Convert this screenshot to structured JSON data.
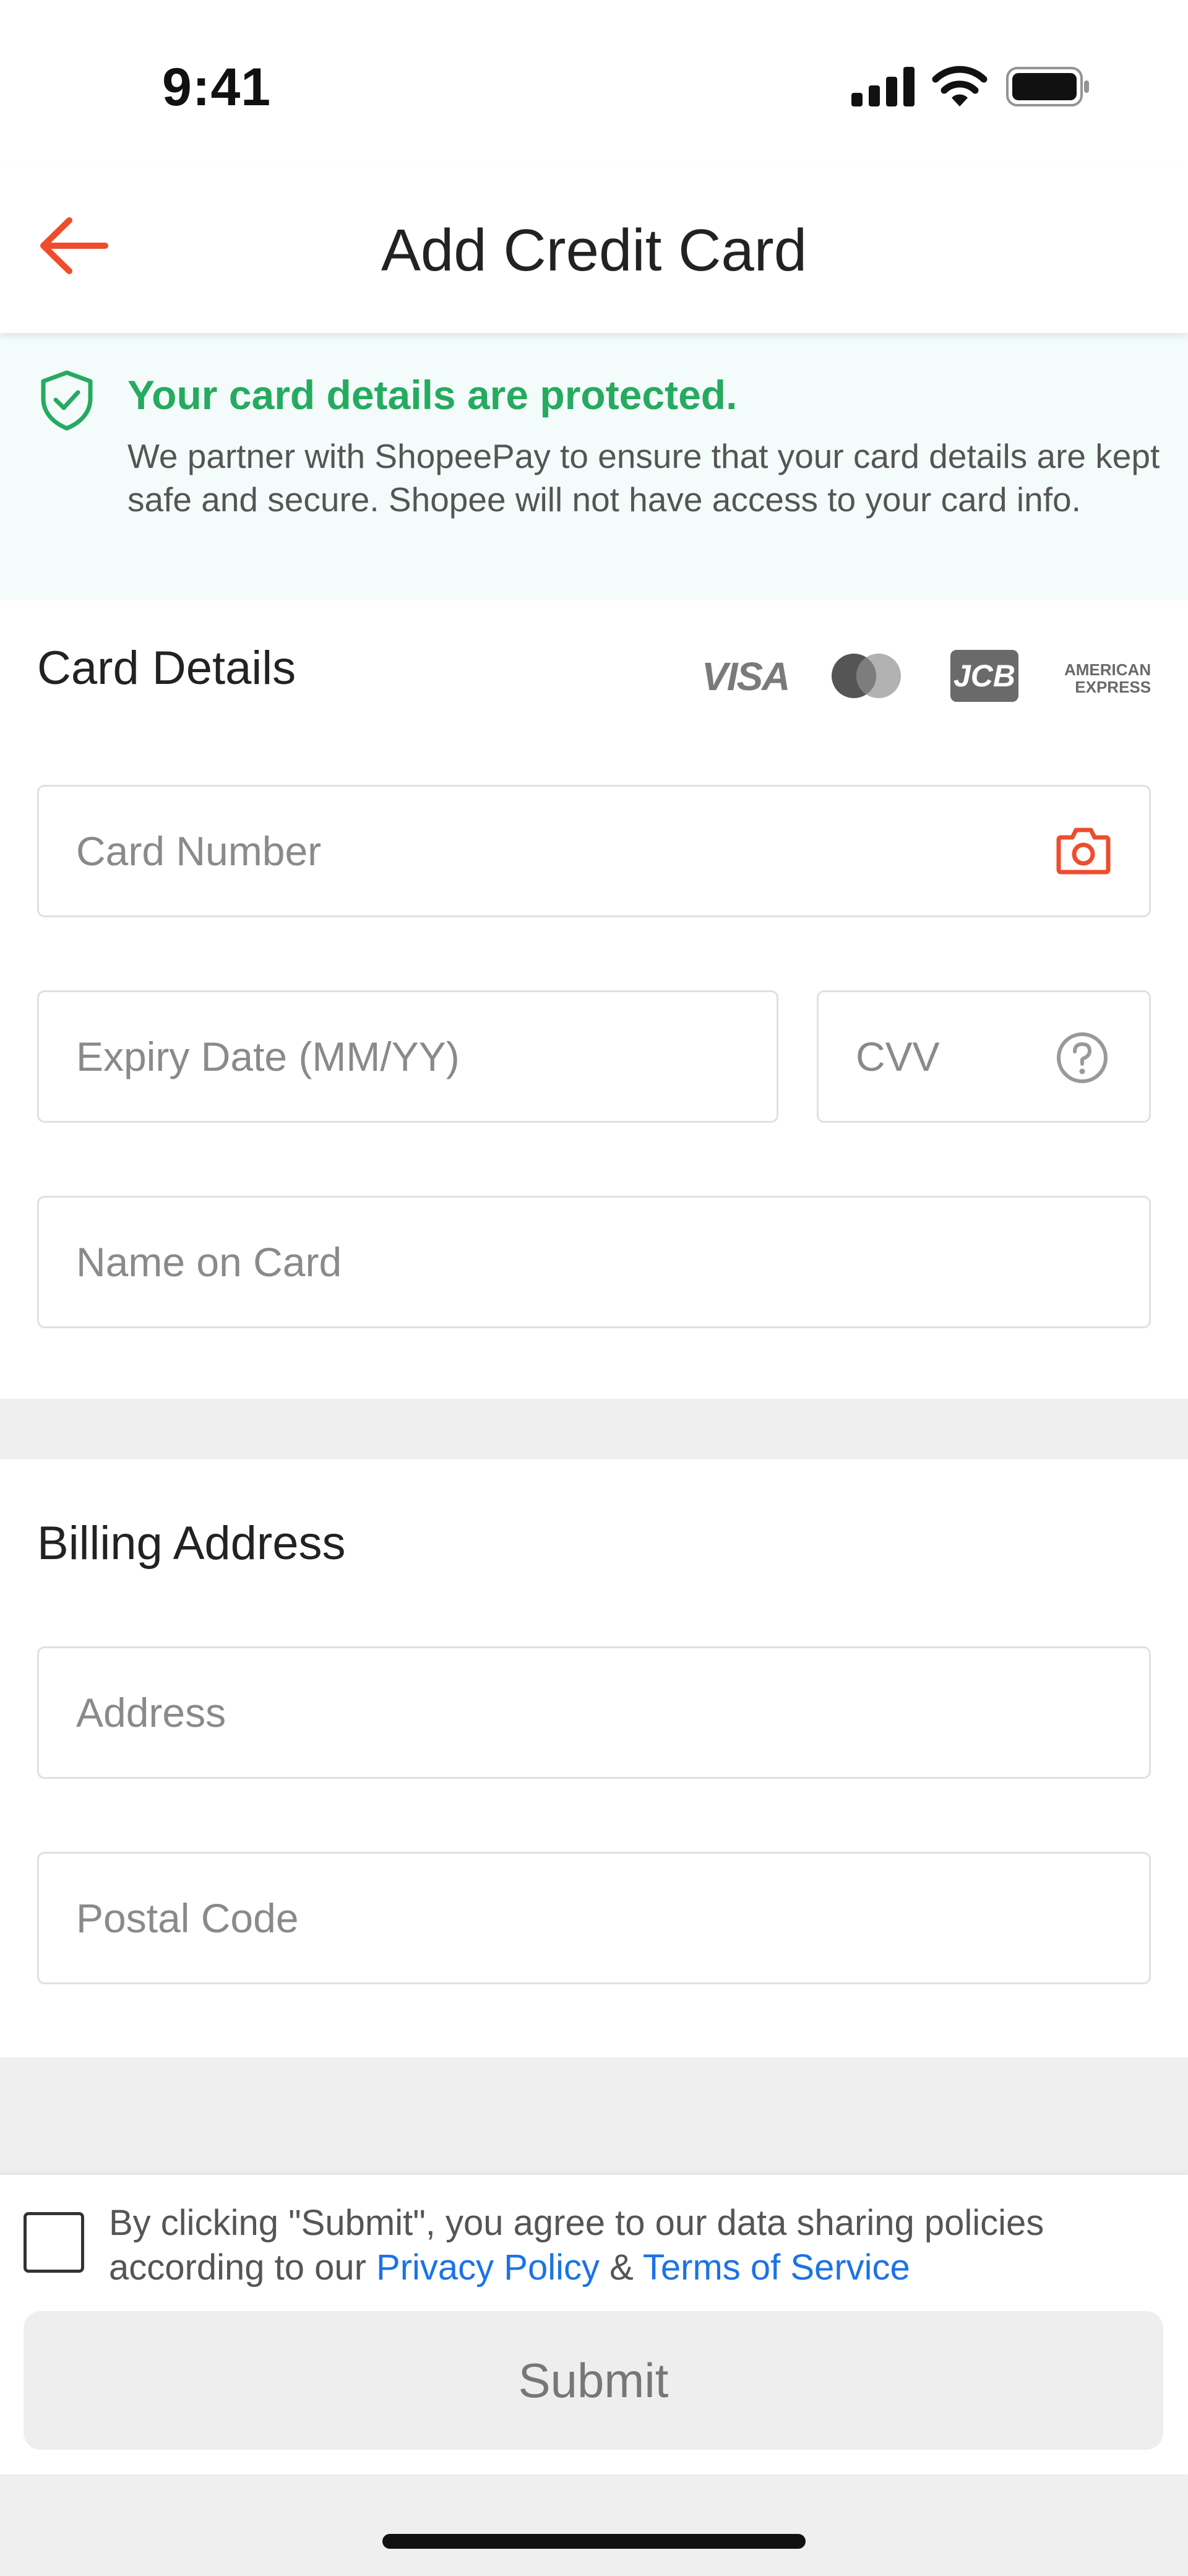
{
  "status_bar": {
    "time": "9:41"
  },
  "nav": {
    "title": "Add Credit Card"
  },
  "protection": {
    "title": "Your card details are protected.",
    "description": "We partner with ShopeePay to ensure that your card details are kept safe and secure. Shopee will not have access to your card info."
  },
  "card_details": {
    "title": "Card Details",
    "brands": {
      "visa": "VISA",
      "jcb": "JCB",
      "amex_line1": "AMERICAN",
      "amex_line2": "EXPRESS"
    },
    "card_number": {
      "placeholder": "Card Number",
      "value": ""
    },
    "expiry": {
      "placeholder": "Expiry Date (MM/YY)",
      "value": ""
    },
    "cvv": {
      "placeholder": "CVV",
      "value": ""
    },
    "name": {
      "placeholder": "Name on Card",
      "value": ""
    }
  },
  "billing": {
    "title": "Billing Address",
    "address": {
      "placeholder": "Address",
      "value": ""
    },
    "postal": {
      "placeholder": "Postal Code",
      "value": ""
    }
  },
  "footer": {
    "agree_prefix": "By clicking \"Submit\", you agree to our data sharing policies according to our ",
    "privacy_link": "Privacy Policy",
    "amp": " & ",
    "terms_link": "Terms of Service",
    "submit_label": "Submit"
  },
  "colors": {
    "accent": "#ee4d2d",
    "protect_green": "#26aa60",
    "link_blue": "#1a73e8"
  }
}
